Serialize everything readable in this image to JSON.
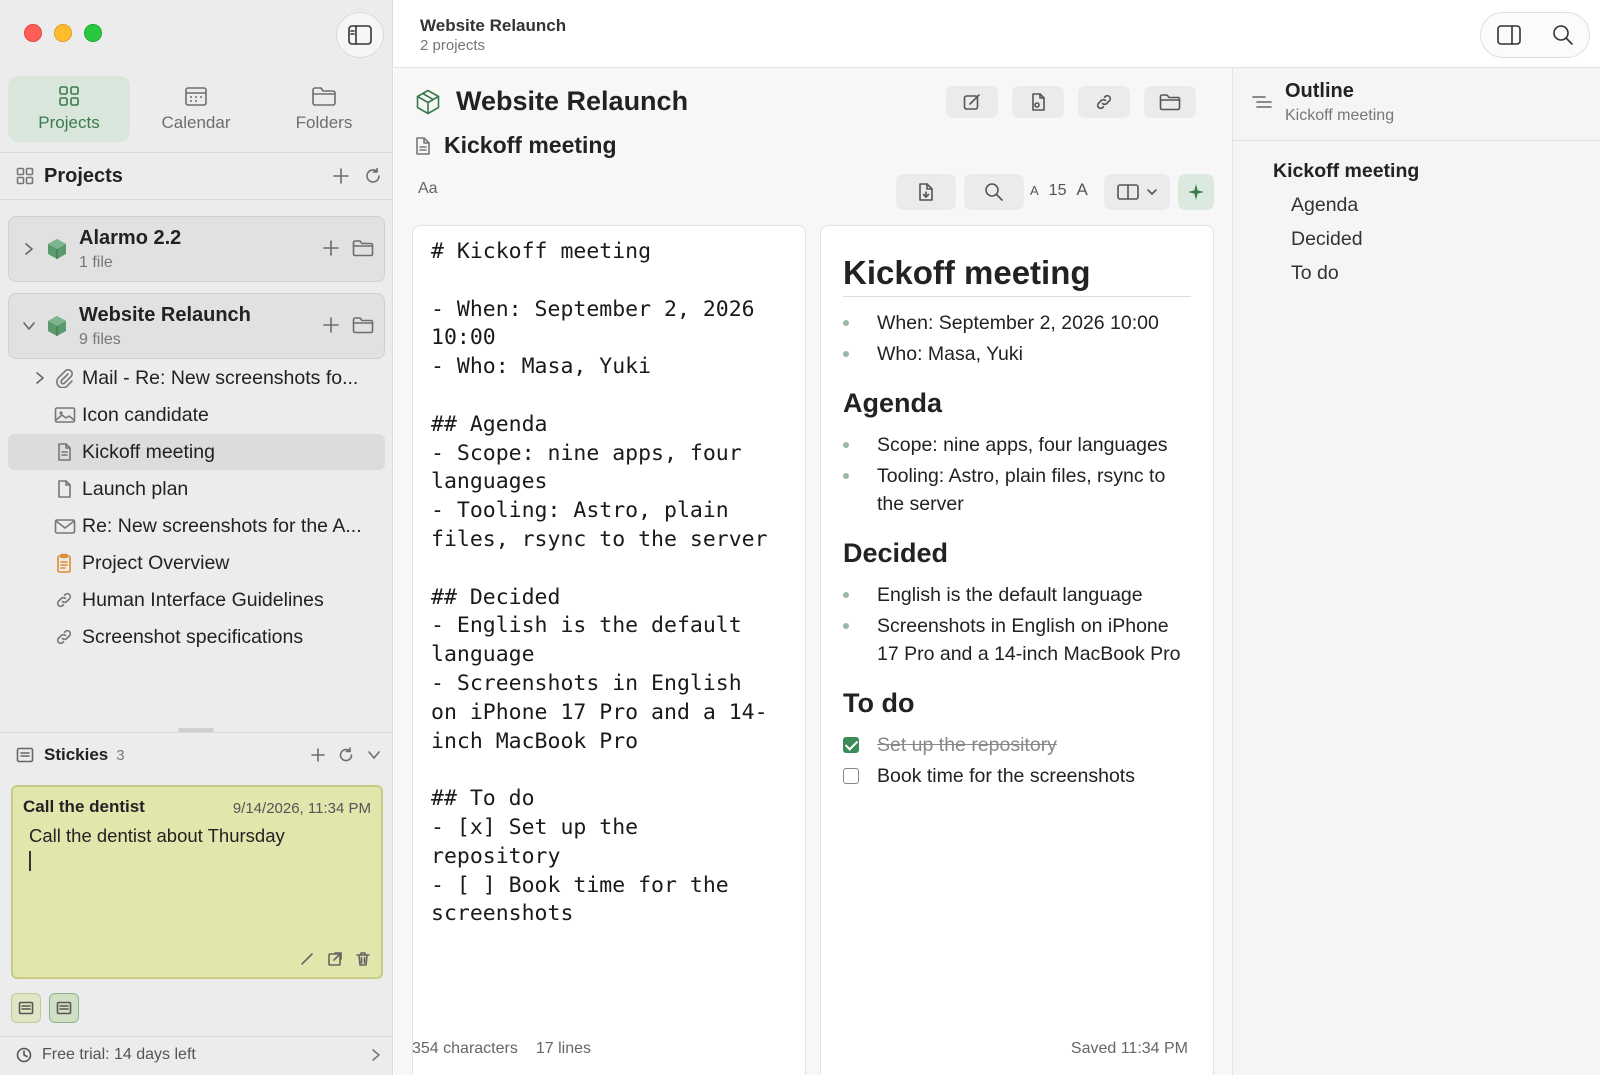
{
  "window": {
    "title": "Website Relaunch",
    "subtitle": "2 projects"
  },
  "nav": {
    "tabs": [
      {
        "label": "Projects",
        "icon": "grid-icon",
        "active": true
      },
      {
        "label": "Calendar",
        "icon": "calendar-icon",
        "active": false
      },
      {
        "label": "Folders",
        "icon": "folder-icon",
        "active": false
      }
    ]
  },
  "projects": {
    "header": "Projects",
    "items": [
      {
        "name": "Alarmo 2.2",
        "count": "1 file",
        "expanded": false
      },
      {
        "name": "Website Relaunch",
        "count": "9 files",
        "expanded": true
      }
    ],
    "files": [
      {
        "label": "Mail - Re: New screenshots fo...",
        "icon": "paperclip-icon",
        "expandable": true
      },
      {
        "label": "Icon candidate",
        "icon": "image-icon"
      },
      {
        "label": "Kickoff meeting",
        "icon": "document-icon",
        "selected": true
      },
      {
        "label": "Launch plan",
        "icon": "document-icon"
      },
      {
        "label": "Re: New screenshots for the A...",
        "icon": "envelope-icon"
      },
      {
        "label": "Project Overview",
        "icon": "clipboard-icon"
      },
      {
        "label": "Human Interface Guidelines",
        "icon": "link-icon"
      },
      {
        "label": "Screenshot specifications",
        "icon": "link-icon"
      }
    ]
  },
  "stickies": {
    "header": "Stickies",
    "count": "3",
    "current": {
      "title": "Call the dentist",
      "time": "9/14/2026, 11:34 PM",
      "body": "Call the dentist about Thursday"
    }
  },
  "trial": {
    "label": "Free trial: 14 days left"
  },
  "document": {
    "project_title": "Website Relaunch",
    "note_title": "Kickoff meeting",
    "format_label": "Aa",
    "font_size": "15",
    "font_small": "A",
    "font_large": "A",
    "source": "# Kickoff meeting\n\n- When: September 2, 2026\n10:00\n- Who: Masa, Yuki\n\n## Agenda\n- Scope: nine apps, four\nlanguages\n- Tooling: Astro, plain\nfiles, rsync to the server\n\n## Decided\n- English is the default\nlanguage\n- Screenshots in English\non iPhone 17 Pro and a 14-\ninch MacBook Pro\n\n## To do\n- [x] Set up the\nrepository\n- [ ] Book time for the\nscreenshots",
    "preview": {
      "h1": "Kickoff meeting",
      "intro": [
        "When: September 2, 2026 10:00",
        "Who: Masa, Yuki"
      ],
      "agenda_title": "Agenda",
      "agenda": [
        "Scope: nine apps, four languages",
        "Tooling: Astro, plain files, rsync to the server"
      ],
      "decided_title": "Decided",
      "decided": [
        "English is the default language",
        "Screenshots in English on iPhone 17 Pro and a 14-inch MacBook Pro"
      ],
      "todo_title": "To do",
      "todo": [
        {
          "text": "Set up the repository",
          "done": true
        },
        {
          "text": "Book time for the screenshots",
          "done": false
        }
      ]
    },
    "status": {
      "characters": "354 characters",
      "lines": "17 lines",
      "saved": "Saved 11:34 PM"
    }
  },
  "outline": {
    "title": "Outline",
    "subtitle": "Kickoff meeting",
    "items": [
      {
        "label": "Kickoff meeting",
        "level": 1
      },
      {
        "label": "Agenda",
        "level": 2
      },
      {
        "label": "Decided",
        "level": 2
      },
      {
        "label": "To do",
        "level": 2
      }
    ]
  },
  "colors": {
    "accent": "#3a7a4c",
    "sticky": "#e2e6ad",
    "close": "#ff5f57",
    "minimize": "#febc2e",
    "zoom": "#28c840"
  }
}
